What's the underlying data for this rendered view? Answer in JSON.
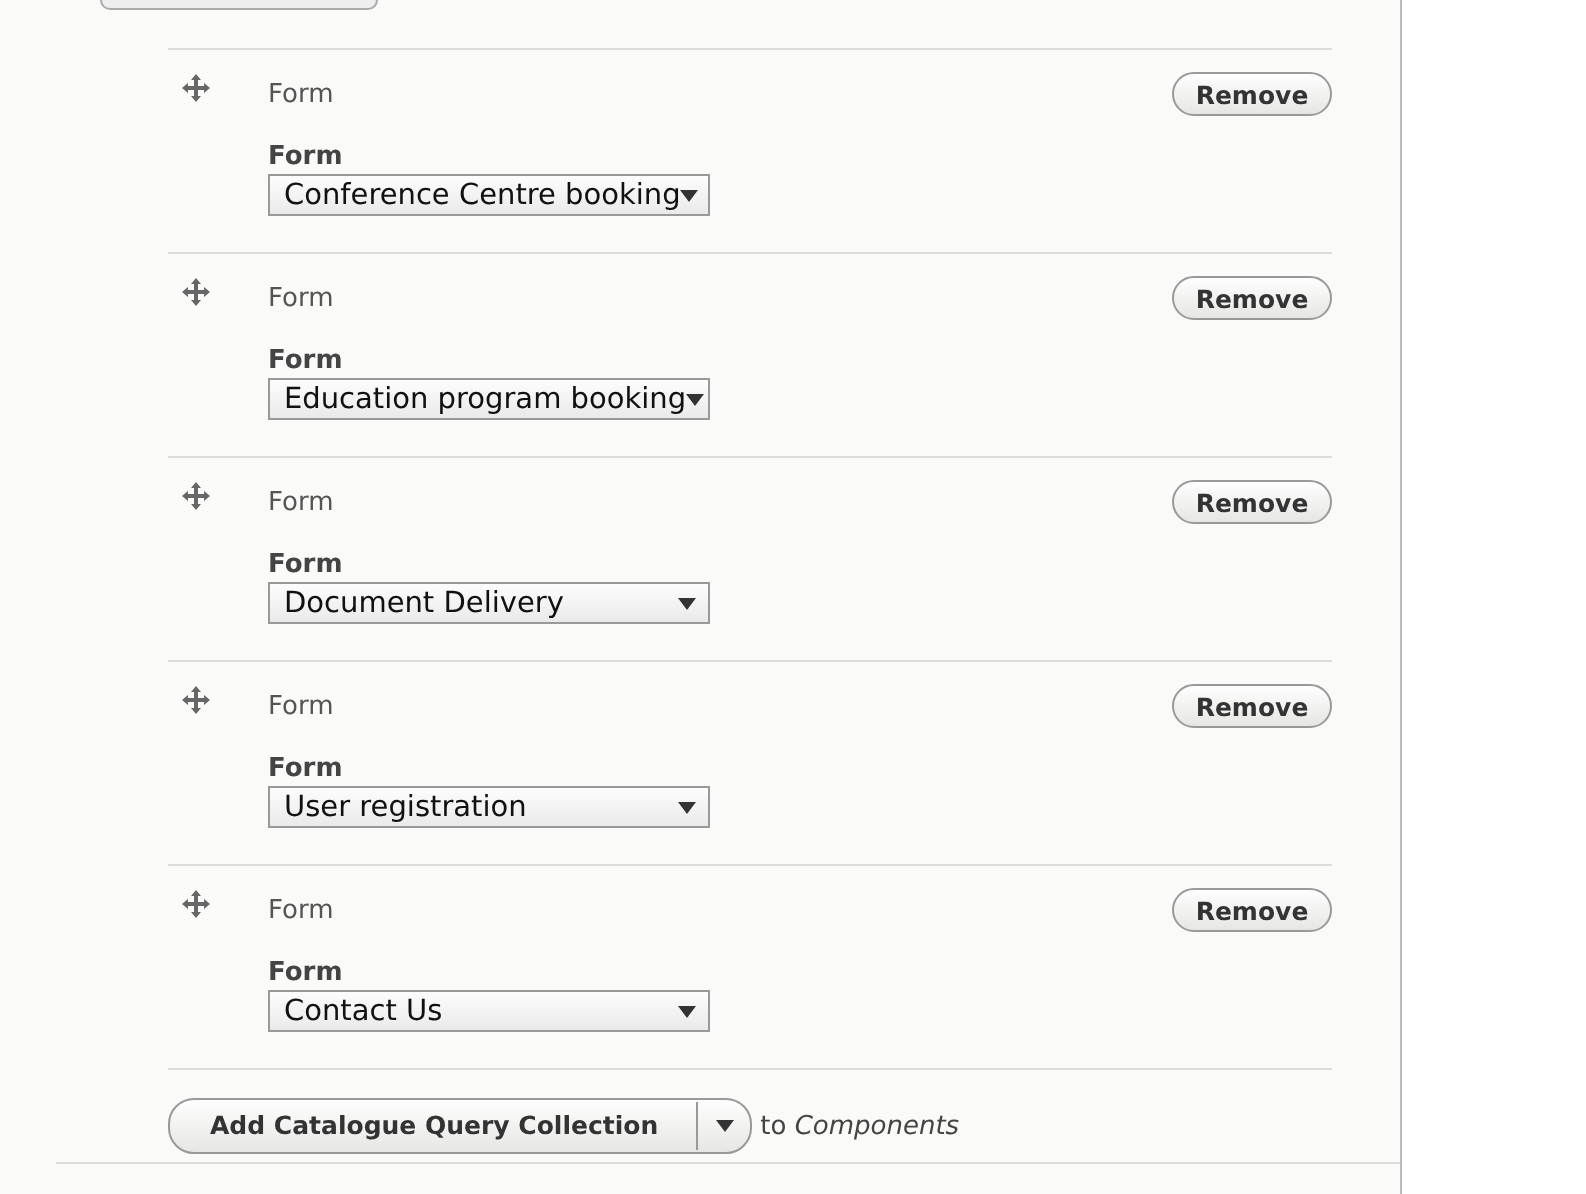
{
  "items": [
    {
      "title": "Form",
      "field_label": "Form",
      "value": "Conference Centre booking",
      "remove": "Remove"
    },
    {
      "title": "Form",
      "field_label": "Form",
      "value": "Education program booking",
      "remove": "Remove"
    },
    {
      "title": "Form",
      "field_label": "Form",
      "value": "Document Delivery",
      "remove": "Remove"
    },
    {
      "title": "Form",
      "field_label": "Form",
      "value": "User registration",
      "remove": "Remove"
    },
    {
      "title": "Form",
      "field_label": "Form",
      "value": "Contact Us",
      "remove": "Remove"
    }
  ],
  "add_button": "Add Catalogue Query Collection",
  "target_prefix": "to",
  "target": "Components"
}
